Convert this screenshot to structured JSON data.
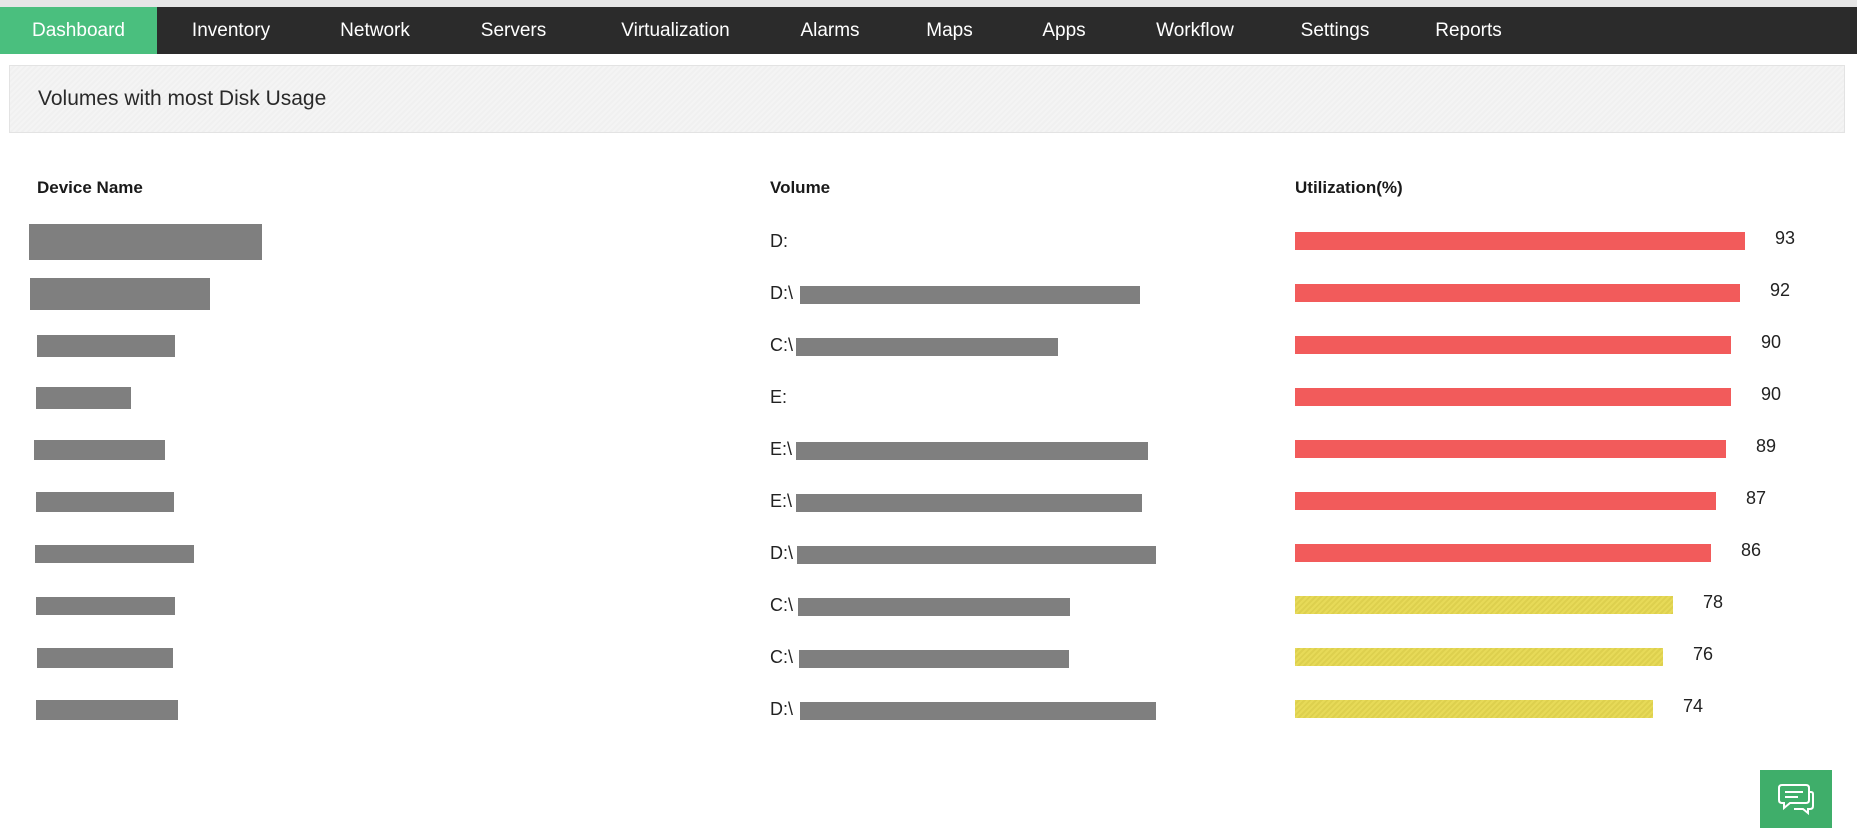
{
  "nav": {
    "items": [
      {
        "label": "Dashboard",
        "active": true
      },
      {
        "label": "Inventory",
        "active": false
      },
      {
        "label": "Network",
        "active": false
      },
      {
        "label": "Servers",
        "active": false
      },
      {
        "label": "Virtualization",
        "active": false
      },
      {
        "label": "Alarms",
        "active": false
      },
      {
        "label": "Maps",
        "active": false
      },
      {
        "label": "Apps",
        "active": false
      },
      {
        "label": "Workflow",
        "active": false
      },
      {
        "label": "Settings",
        "active": false
      },
      {
        "label": "Reports",
        "active": false
      }
    ]
  },
  "widget": {
    "title": "Volumes with most Disk Usage",
    "columns": {
      "device": "Device Name",
      "volume": "Volume",
      "utilization": "Utilization(%)"
    },
    "rows": [
      {
        "volume_prefix": "D:",
        "utilization": 93,
        "status": "critical"
      },
      {
        "volume_prefix": "D:\\",
        "utilization": 92,
        "status": "critical"
      },
      {
        "volume_prefix": "C:\\",
        "utilization": 90,
        "status": "critical"
      },
      {
        "volume_prefix": "E:",
        "utilization": 90,
        "status": "critical"
      },
      {
        "volume_prefix": "E:\\",
        "utilization": 89,
        "status": "critical"
      },
      {
        "volume_prefix": "E:\\",
        "utilization": 87,
        "status": "critical"
      },
      {
        "volume_prefix": "D:\\",
        "utilization": 86,
        "status": "critical"
      },
      {
        "volume_prefix": "C:\\",
        "utilization": 78,
        "status": "warning"
      },
      {
        "volume_prefix": "C:\\",
        "utilization": 76,
        "status": "warning"
      },
      {
        "volume_prefix": "D:\\",
        "utilization": 74,
        "status": "warning"
      }
    ]
  },
  "colors": {
    "nav_bg": "#2b2b2b",
    "nav_active": "#4abf7e",
    "critical": "#f25b5b",
    "warning": "#e7da58",
    "chat_button": "#3fae6a"
  },
  "icons": {
    "chat": "chat-bubble-icon"
  }
}
